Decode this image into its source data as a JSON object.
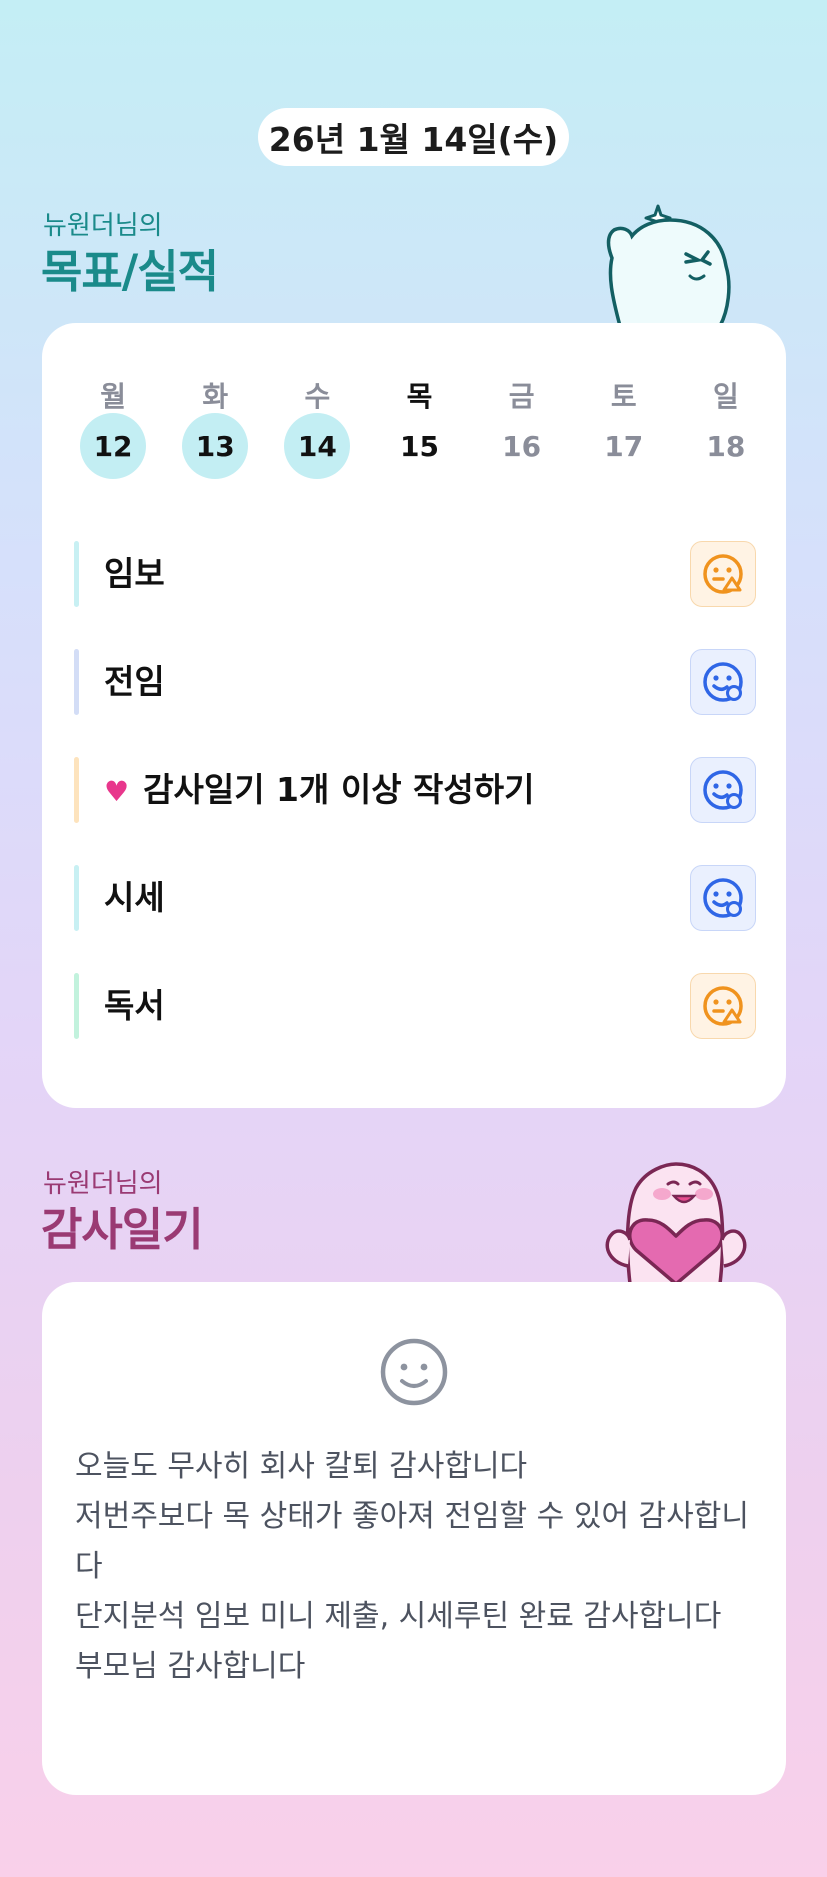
{
  "date_label": "26년 1월 14일(수)",
  "goals_section": {
    "subtitle": "뉴원더님의",
    "title": "목표/실적"
  },
  "week": {
    "days": [
      "월",
      "화",
      "수",
      "목",
      "금",
      "토",
      "일"
    ],
    "dates": [
      "12",
      "13",
      "14",
      "15",
      "16",
      "17",
      "18"
    ]
  },
  "goals": [
    {
      "label": "임보",
      "bar_color": "#c8f0f3",
      "status_icon": "smile-triangle-icon"
    },
    {
      "label": "전임",
      "bar_color": "#d3ddf6",
      "status_icon": "smile-circle-icon"
    },
    {
      "label": "감사일기 1개 이상 작성하기",
      "bar_color": "#fde3bd",
      "has_heart": true,
      "heart_icon": "heart-emoji",
      "status_icon": "smile-circle-icon"
    },
    {
      "label": "시세",
      "bar_color": "#c8f0f3",
      "status_icon": "smile-circle-icon"
    },
    {
      "label": "독서",
      "bar_color": "#c2f2dd",
      "status_icon": "smile-triangle-icon"
    }
  ],
  "diary_section": {
    "subtitle": "뉴원더님의",
    "title": "감사일기"
  },
  "diary": {
    "mood_icon": "smiley-face-icon",
    "text": "오늘도 무사히 회사 칼퇴 감사합니다\n저번주보다 목 상태가 좋아져 전임할 수 있어 감사합니다\n단지분석 임보 미니 제출, 시세루틴 완료 감사합니다\n부모님 감사합니다"
  },
  "colors": {
    "accent_teal": "#1a8a8a",
    "accent_plum": "#9a3a73",
    "done_day": "#c3eef3",
    "status_orange": "#f0931e",
    "status_blue": "#2f66e6"
  }
}
